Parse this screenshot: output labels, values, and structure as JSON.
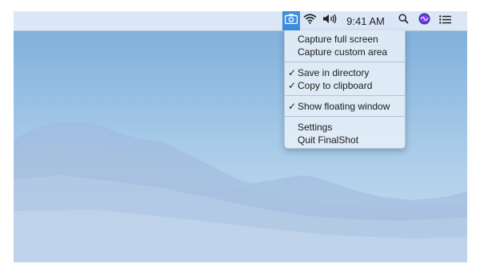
{
  "menubar": {
    "app_icon": "camera-icon",
    "wifi_icon": "wifi-icon",
    "volume_icon": "speaker-volume-icon",
    "clock": "9:41 AM",
    "search_icon": "spotlight-search-icon",
    "siri_icon": "siri-icon",
    "notifications_icon": "notification-center-icon",
    "app_highlight_color": "#3d8ee0"
  },
  "menu": {
    "items": [
      {
        "label": "Capture full screen",
        "checked": false
      },
      {
        "label": "Capture custom area",
        "checked": false
      },
      {
        "label": "Save in directory",
        "checked": true
      },
      {
        "label": "Copy to clipboard",
        "checked": true
      },
      {
        "label": "Show floating window",
        "checked": true
      },
      {
        "label": "Settings",
        "checked": false
      },
      {
        "label": "Quit FinalShot",
        "checked": false
      }
    ],
    "check_glyph": "✓"
  }
}
